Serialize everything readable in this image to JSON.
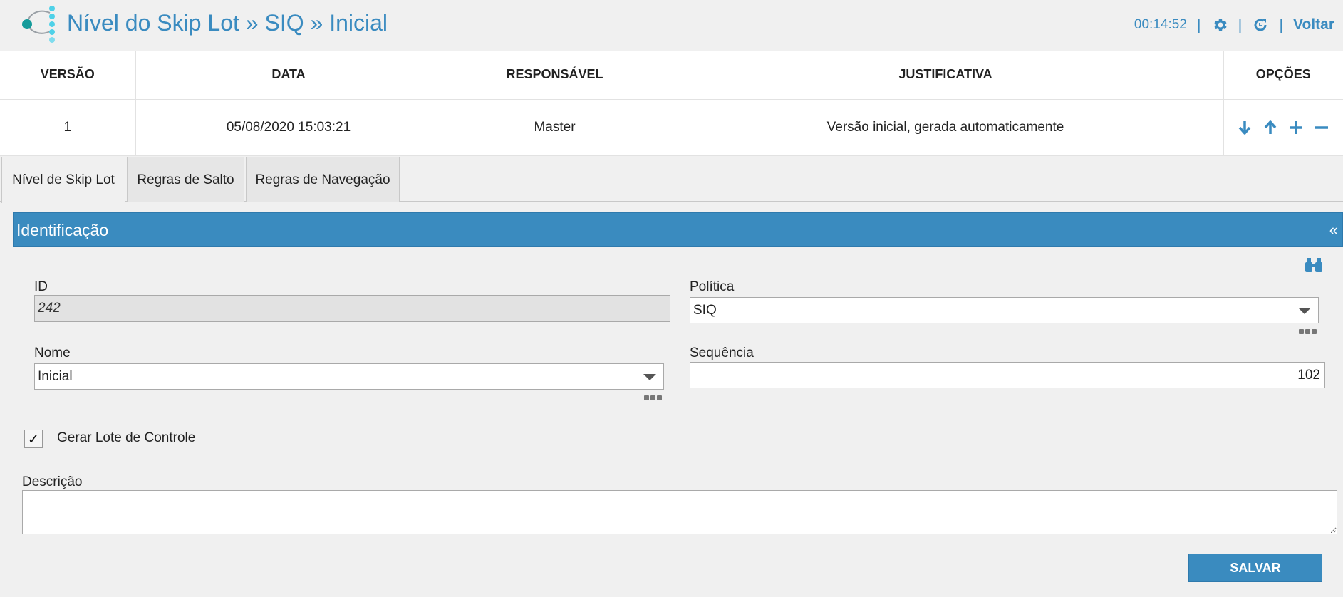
{
  "header": {
    "title": "Nível do Skip Lot » SIQ » Inicial",
    "clock": "00:14:52",
    "separator": "|",
    "back_label": "Voltar"
  },
  "versions": {
    "columns": [
      "VERSÃO",
      "DATA",
      "RESPONSÁVEL",
      "JUSTIFICATIVA",
      "OPÇÕES"
    ],
    "rows": [
      [
        "1",
        "05/08/2020 15:03:21",
        "Master",
        "Versão inicial, gerada automaticamente"
      ]
    ]
  },
  "tabs": [
    {
      "label": "Nível de Skip Lot",
      "active": true
    },
    {
      "label": "Regras de Salto",
      "active": false
    },
    {
      "label": "Regras de Navegação",
      "active": false
    }
  ],
  "panel": {
    "title": "Identificação",
    "collapse_glyph": "«"
  },
  "form": {
    "id_label": "ID",
    "id_value": "242",
    "politica_label": "Política",
    "politica_value": "SIQ",
    "nome_label": "Nome",
    "nome_value": "Inicial",
    "sequencia_label": "Sequência",
    "sequencia_value": "102",
    "checkbox_label": "Gerar Lote de Controle",
    "checkbox_checked": true,
    "checkbox_glyph": "✓",
    "descricao_label": "Descrição",
    "descricao_value": "",
    "save_label": "SALVAR"
  },
  "colors": {
    "accent": "#3a8bc0",
    "logo_teal": "#1aa3a3",
    "logo_cyan": "#4fd1e8"
  },
  "icons": [
    "logo-icon",
    "gear-icon",
    "refresh-icon",
    "arrow-down-icon",
    "arrow-up-icon",
    "plus-icon",
    "minus-icon",
    "binoculars-icon",
    "dropdown-caret-icon",
    "more-dots-icon"
  ]
}
